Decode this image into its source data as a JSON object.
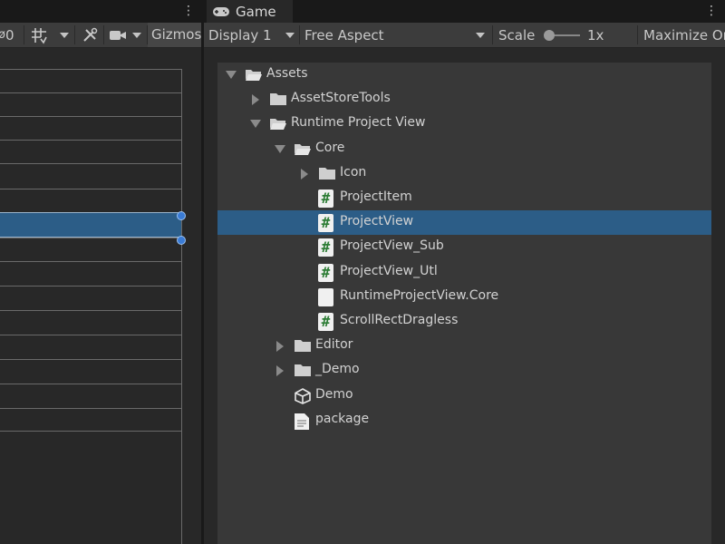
{
  "scene": {
    "toolbar": {
      "gizmo_count": "0",
      "gizmos_label": "Gizmos"
    }
  },
  "game": {
    "tab_label": "Game",
    "toolbar": {
      "display": "Display 1",
      "aspect": "Free Aspect",
      "scale_label": "Scale",
      "scale_value": "1x",
      "maximize": "Maximize On Play"
    }
  },
  "tree": {
    "items": [
      {
        "label": "Assets",
        "depth": 0,
        "icon": "folder-open-icon",
        "expander": "expanded"
      },
      {
        "label": "AssetStoreTools",
        "depth": 1,
        "icon": "folder-icon",
        "expander": "collapsed"
      },
      {
        "label": "Runtime Project View",
        "depth": 1,
        "icon": "folder-open-icon",
        "expander": "expanded"
      },
      {
        "label": "Core",
        "depth": 2,
        "icon": "folder-open-icon",
        "expander": "expanded"
      },
      {
        "label": "Icon",
        "depth": 3,
        "icon": "folder-icon",
        "expander": "collapsed"
      },
      {
        "label": "ProjectItem",
        "depth": 3,
        "icon": "csharp-script-icon",
        "expander": "none"
      },
      {
        "label": "ProjectView",
        "depth": 3,
        "icon": "csharp-script-icon",
        "expander": "none",
        "selected": true
      },
      {
        "label": "ProjectView_Sub",
        "depth": 3,
        "icon": "csharp-script-icon",
        "expander": "none"
      },
      {
        "label": "ProjectView_Utl",
        "depth": 3,
        "icon": "csharp-script-icon",
        "expander": "none"
      },
      {
        "label": "RuntimeProjectView.Core",
        "depth": 3,
        "icon": "asmdef-file-icon",
        "expander": "none"
      },
      {
        "label": "ScrollRectDragless",
        "depth": 3,
        "icon": "csharp-script-icon",
        "expander": "none"
      },
      {
        "label": "Editor",
        "depth": 2,
        "icon": "folder-icon",
        "expander": "collapsed"
      },
      {
        "label": "_Demo",
        "depth": 2,
        "icon": "folder-icon",
        "expander": "collapsed"
      },
      {
        "label": "Demo",
        "depth": 2,
        "icon": "unity-scene-icon",
        "expander": "none"
      },
      {
        "label": "package",
        "depth": 2,
        "icon": "text-document-icon",
        "expander": "none"
      }
    ]
  },
  "colors": {
    "selection": "#2c5d87",
    "panel": "#383838",
    "toolbar": "#3c3c3c",
    "handle": "#3a7bd5"
  }
}
